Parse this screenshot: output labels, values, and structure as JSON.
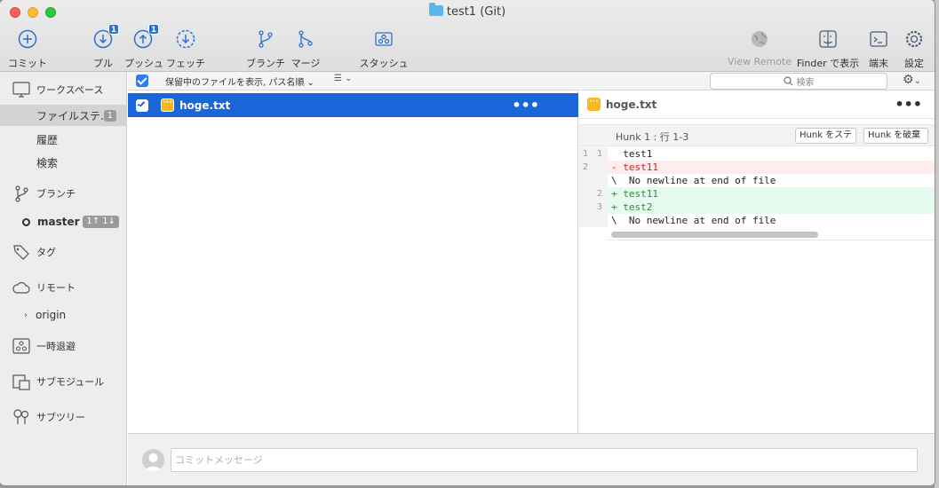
{
  "window": {
    "title": "test1 (Git)"
  },
  "toolbar": {
    "commit": "コミット",
    "pull": "プル",
    "pull_badge": "1",
    "push": "プッシュ",
    "push_badge": "1",
    "fetch": "フェッチ",
    "branch": "ブランチ",
    "merge": "マージ",
    "stash": "スタッシュ",
    "view_remote": "View Remote",
    "finder": "Finder で表示",
    "terminal": "端末",
    "settings": "設定"
  },
  "sidebar": {
    "workspace": "ワークスペース",
    "file_status": "ファイルステ…",
    "file_status_count": "1",
    "history": "履歴",
    "search": "検索",
    "branches": "ブランチ",
    "master": "master",
    "master_badge": "1↑ 1↓",
    "tags": "タグ",
    "remotes": "リモート",
    "origin": "origin",
    "stashes": "一時退避",
    "submodules": "サブモジュール",
    "subtrees": "サブツリー"
  },
  "filter": {
    "sort_label": "保留中のファイルを表示, パス名順",
    "search_placeholder": "検索"
  },
  "files": [
    {
      "name": "hoge.txt",
      "checked": true
    }
  ],
  "diff": {
    "file": "hoge.txt",
    "hunk_label": "Hunk 1 : 行 1-3",
    "stage_hunk": "Hunk をステ",
    "discard_hunk": "Hunk を破棄",
    "lines": [
      {
        "old": "1",
        "new": "1",
        "text": "  test1",
        "type": "context"
      },
      {
        "old": "2",
        "new": "",
        "text": "- test11",
        "type": "del"
      },
      {
        "old": "",
        "new": "",
        "text": "\\  No newline at end of file",
        "type": "context"
      },
      {
        "old": "",
        "new": "2",
        "text": "+ test11",
        "type": "add"
      },
      {
        "old": "",
        "new": "3",
        "text": "+ test2",
        "type": "add"
      },
      {
        "old": "",
        "new": "",
        "text": "\\  No newline at end of file",
        "type": "context"
      }
    ]
  },
  "commit": {
    "placeholder": "コミットメッセージ"
  },
  "colors": {
    "accent": "#1a65d8",
    "del_bg": "#ffecec",
    "add_bg": "#e6fbef",
    "del_text": "#c62828",
    "add_text": "#2e8b3a"
  }
}
